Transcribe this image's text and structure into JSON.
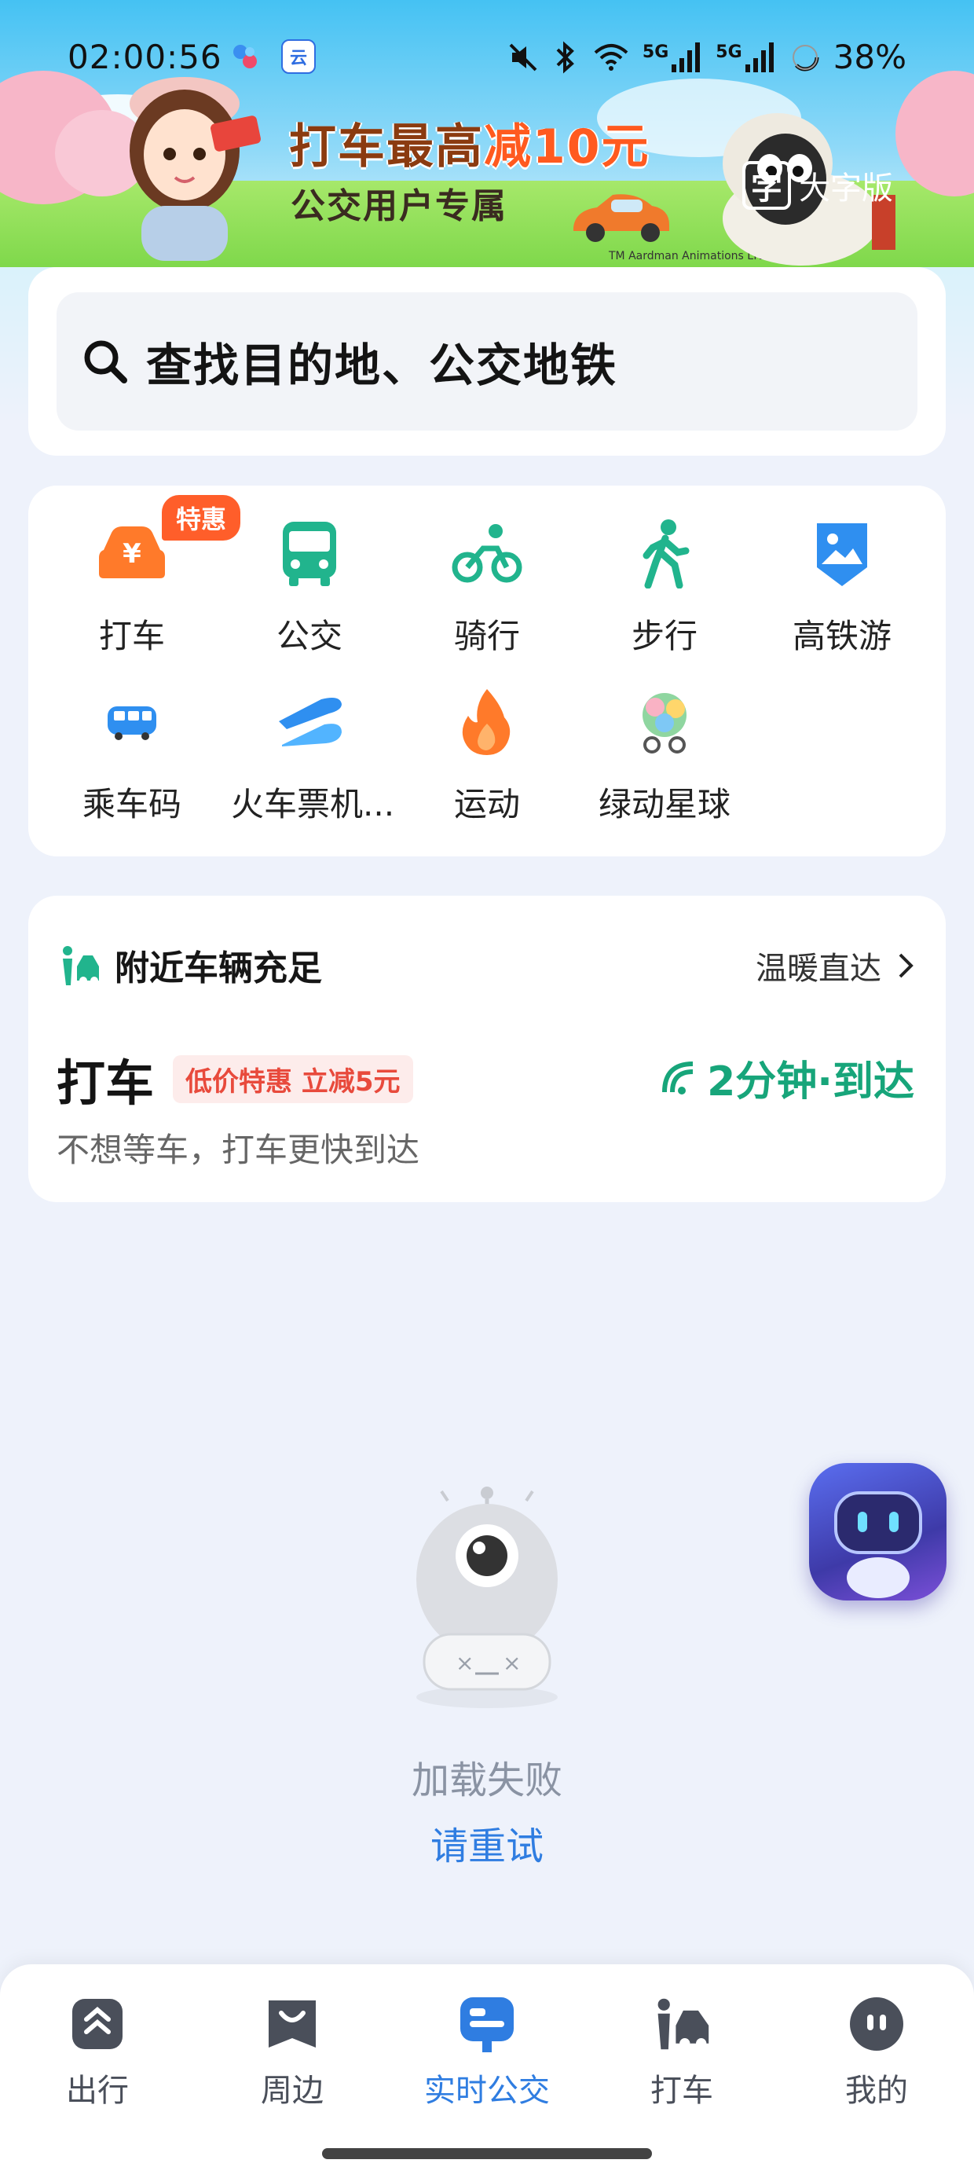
{
  "status_bar": {
    "time": "02:00:56",
    "network": "5G",
    "network2": "5G",
    "battery": "38%",
    "app_icon_2_text": "云"
  },
  "banner": {
    "title_part1": "打车最高",
    "title_highlight": "减10元",
    "subtitle": "公交用户专属",
    "big_font_label": "大字版",
    "big_font_icon_char": "字",
    "copyright": "TM Aardman Animations LTD.2023"
  },
  "search": {
    "placeholder": "查找目的地、公交地铁"
  },
  "services": {
    "badge": "特惠",
    "items": [
      {
        "label": "打车",
        "icon": "taxi-icon"
      },
      {
        "label": "公交",
        "icon": "bus-icon"
      },
      {
        "label": "骑行",
        "icon": "bike-icon"
      },
      {
        "label": "步行",
        "icon": "walk-icon"
      },
      {
        "label": "高铁游",
        "icon": "picture-icon"
      },
      {
        "label": "乘车码",
        "icon": "bus-code-icon"
      },
      {
        "label": "火车票机...",
        "icon": "train-plane-icon"
      },
      {
        "label": "运动",
        "icon": "flame-icon"
      },
      {
        "label": "绿动星球",
        "icon": "green-planet-icon"
      }
    ]
  },
  "taxi_card": {
    "header": "附近车辆充足",
    "link": "温暖直达",
    "title": "打车",
    "promo": "低价特惠 立减5元",
    "eta": "2分钟·到达",
    "desc": "不想等车，打车更快到达"
  },
  "empty_state": {
    "message": "加载失败",
    "retry": "请重试"
  },
  "tabbar": {
    "items": [
      {
        "label": "出行",
        "active": false
      },
      {
        "label": "周边",
        "active": false
      },
      {
        "label": "实时公交",
        "active": true
      },
      {
        "label": "打车",
        "active": false
      },
      {
        "label": "我的",
        "active": false
      }
    ]
  },
  "colors": {
    "accent_blue": "#2f7de1",
    "green": "#17a57a",
    "orange": "#ff7a2a",
    "promo_red": "#e84a3c"
  }
}
